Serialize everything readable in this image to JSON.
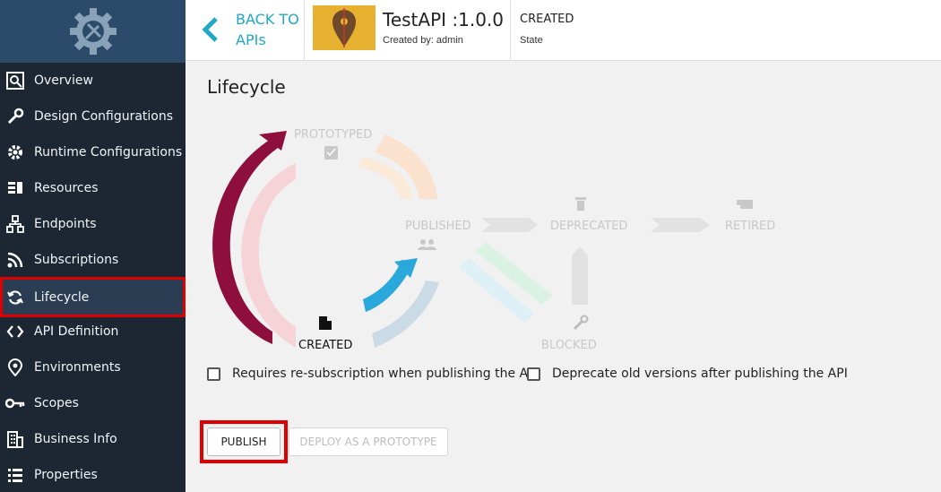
{
  "header": {
    "back_label_line1": "BACK TO",
    "back_label_line2": "APIs",
    "api_name": "TestAPI :1.0.0",
    "created_by": "Created by: admin",
    "state_value": "CREATED",
    "state_label": "State"
  },
  "sidebar": {
    "logo_icon": "gear-tools-icon",
    "items": [
      {
        "label": "Overview",
        "icon": "overview-icon"
      },
      {
        "label": "Design Configurations",
        "icon": "wrench-icon"
      },
      {
        "label": "Runtime Configurations",
        "icon": "gear-icon"
      },
      {
        "label": "Resources",
        "icon": "resources-icon"
      },
      {
        "label": "Endpoints",
        "icon": "endpoints-icon"
      },
      {
        "label": "Subscriptions",
        "icon": "rss-icon"
      },
      {
        "label": "Lifecycle",
        "icon": "refresh-icon",
        "active": true
      },
      {
        "label": "API Definition",
        "icon": "code-icon"
      },
      {
        "label": "Environments",
        "icon": "location-pin-icon"
      },
      {
        "label": "Scopes",
        "icon": "key-icon"
      },
      {
        "label": "Business Info",
        "icon": "building-icon"
      },
      {
        "label": "Properties",
        "icon": "list-icon"
      }
    ]
  },
  "main": {
    "title": "Lifecycle",
    "stages": {
      "prototyped": "PROTOTYPED",
      "published": "PUBLISHED",
      "deprecated": "DEPRECATED",
      "retired": "RETIRED",
      "created": "CREATED",
      "blocked": "BLOCKED"
    },
    "options": {
      "resubscription": "Requires re-subscription when publishing the API",
      "deprecate_old": "Deprecate old versions after publishing the API"
    },
    "buttons": {
      "publish": "PUBLISH",
      "deploy": "DEPLOY AS A PROTOTYPE"
    }
  },
  "colors": {
    "sidebar_bg": "#1d2733",
    "accent": "#20a8c8",
    "highlight": "#e00000",
    "arrow_maroon": "#8e0f3d",
    "arrow_blue": "#2aa8dc"
  }
}
